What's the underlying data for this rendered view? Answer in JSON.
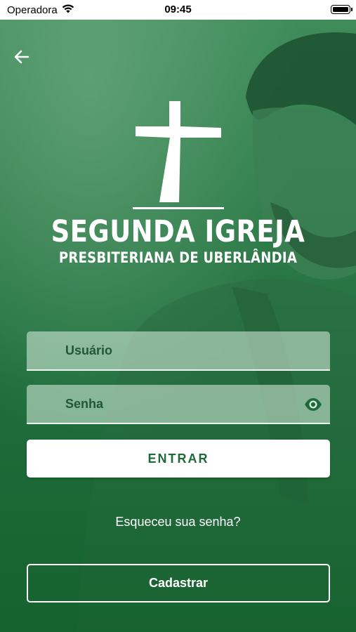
{
  "status_bar": {
    "carrier": "Operadora",
    "time": "09:45",
    "wifi_icon": "wifi-icon",
    "battery_icon": "battery-icon"
  },
  "colors": {
    "primary_green": "#1d6a3a",
    "field_text": "#1d5a33",
    "background_top": "#3f8c5a",
    "background_bottom": "#17652f"
  },
  "header": {
    "back_icon": "arrow-left-icon"
  },
  "logo": {
    "icon": "cross-icon",
    "title": "SEGUNDA IGREJA",
    "subtitle": "PRESBITERIANA DE UBERLÂNDIA"
  },
  "form": {
    "username_label": "Usuário",
    "password_label": "Senha",
    "password_toggle_icon": "eye-icon",
    "login_button": "ENTRAR",
    "forgot_password": "Esqueceu sua senha?",
    "register_button": "Cadastrar"
  }
}
